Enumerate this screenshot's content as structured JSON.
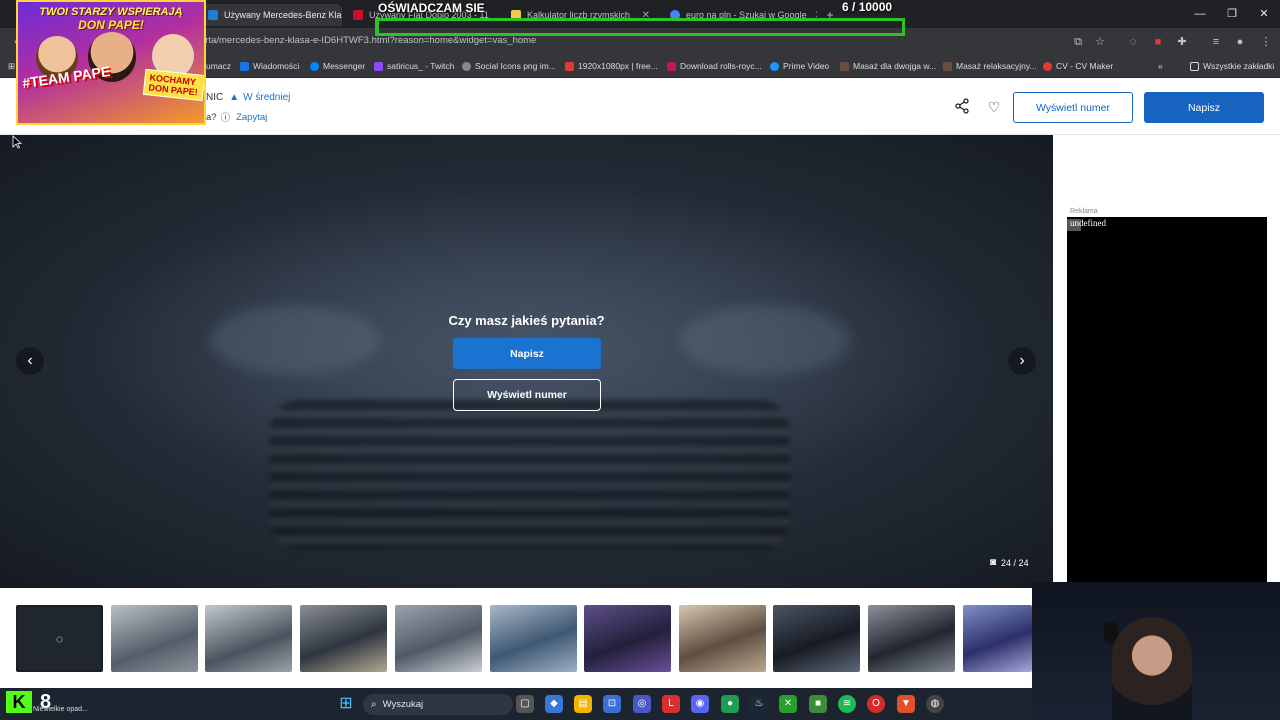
{
  "browser": {
    "tabs": [
      {
        "title": "Używany Mercedes-Benz Klasa",
        "active": true,
        "color": "#1c7fd6"
      },
      {
        "title": "Używany Fiat Doblo 2003 - 11",
        "active": false,
        "color": "#c8102e"
      },
      {
        "title": "Kalkulator liczb rzymskich",
        "active": false,
        "color": "#f2c94c"
      },
      {
        "title": "euro na pln - Szukaj w Google",
        "active": false,
        "color": "#4285f4"
      }
    ],
    "new_tab": "+",
    "close_glyph": "✕",
    "url": "erta/mercedes-benz-klasa-e-ID6HTWF3.html?reason=home&widget=vas_home",
    "bookmarks": [
      {
        "label": "umacz",
        "color": "#4a90e2"
      },
      {
        "label": "Wiadomości",
        "color": "#1a73e8"
      },
      {
        "label": "Messenger",
        "color": "#0084ff"
      },
      {
        "label": "satiricus_ - Twitch",
        "color": "#9146ff"
      },
      {
        "label": "Social Icons png im...",
        "color": "#888888"
      },
      {
        "label": "1920x1080px | free...",
        "color": "#e53935"
      },
      {
        "label": "Download rolls-royc...",
        "color": "#c2185b"
      },
      {
        "label": "Prime Video",
        "color": "#1a98ff"
      },
      {
        "label": "Masaż dla dwojga w...",
        "color": "#6d4c41"
      },
      {
        "label": "Masaż relaksacyjny...",
        "color": "#6d4c41"
      },
      {
        "label": "CV - CV Maker",
        "color": "#e53935"
      }
    ],
    "bookmarks_more": "»",
    "all_bookmarks": "Wszystkie zakładki"
  },
  "stream": {
    "title": "OŚWIADCZAM SIE",
    "goal_current": "6",
    "goal_total": "/ 10000",
    "goal_fraction": 0.0006,
    "promo_top": "TWOI STARZY WSPIERAJĄ",
    "promo_name": "DON PAPE!",
    "promo_team": "#TEAM PAPE",
    "promo_love": "KOCHAMY DON PAPE!"
  },
  "header": {
    "seller_suffix": "NIC",
    "seller_badge": "W średniej",
    "ask_prefix": "a?",
    "ask_link": "Zapytaj",
    "show_number": "Wyświetl numer",
    "write": "Napisz"
  },
  "gallery": {
    "question": "Czy masz jakieś pytania?",
    "write": "Napisz",
    "show_number": "Wyświetl numer",
    "counter": "24 / 24",
    "prev": "‹",
    "next": "›"
  },
  "ad": {
    "label": "Reklama",
    "text": "undefined"
  },
  "thumbnails": {
    "count": 11,
    "colors": [
      "#202630",
      "#7b8691",
      "#8a939c",
      "#6f7a84",
      "#7f8790",
      "#6a7a8e",
      "#3a3550",
      "#8f8778",
      "#2f3644",
      "#3d434d",
      "#4a4f75"
    ]
  },
  "taskbar": {
    "kick_letter": "K",
    "number": "8",
    "weather": "Niewielkie opad...",
    "search": "Wyszukaj"
  }
}
